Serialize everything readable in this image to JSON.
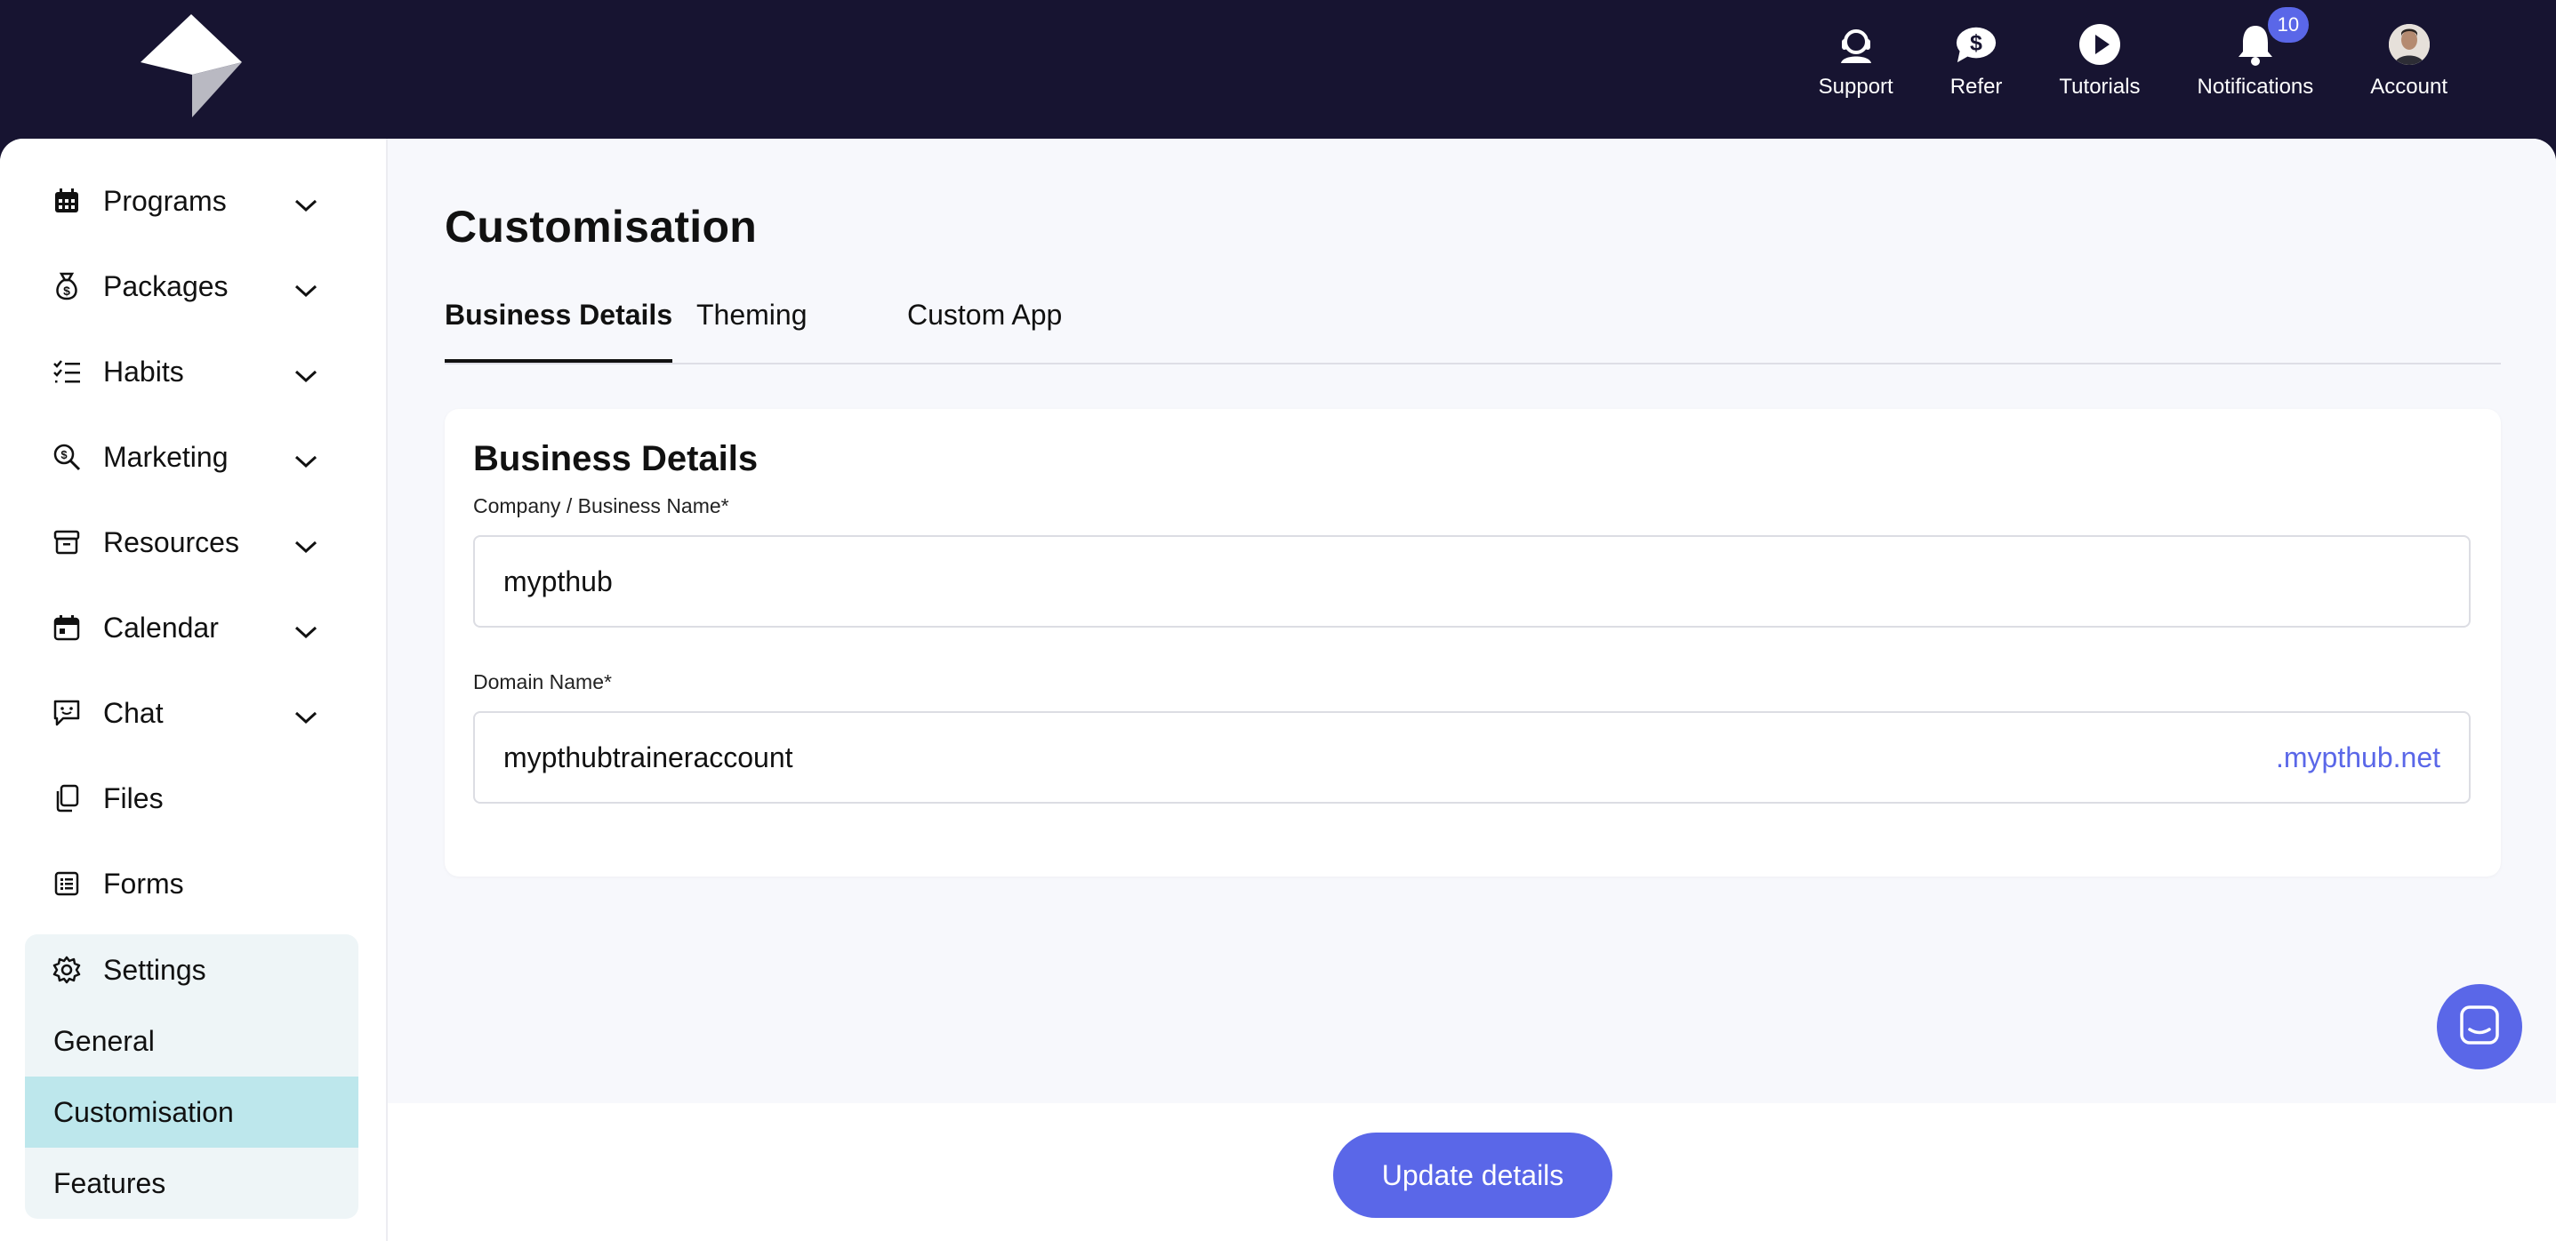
{
  "header": {
    "logo_icon": "brand-logo-icon",
    "items": [
      {
        "label": "Support",
        "icon": "headset-icon"
      },
      {
        "label": "Refer",
        "icon": "dollar-chat-icon"
      },
      {
        "label": "Tutorials",
        "icon": "play-icon"
      },
      {
        "label": "Notifications",
        "icon": "bell-icon",
        "badge": "10"
      },
      {
        "label": "Account",
        "icon": "avatar"
      }
    ]
  },
  "sidebar": {
    "items": [
      {
        "label": "Programs",
        "icon": "calendar-grid-icon",
        "expandable": true
      },
      {
        "label": "Packages",
        "icon": "money-bag-icon",
        "expandable": true
      },
      {
        "label": "Habits",
        "icon": "checklist-icon",
        "expandable": true
      },
      {
        "label": "Marketing",
        "icon": "search-dollar-icon",
        "expandable": true
      },
      {
        "label": "Resources",
        "icon": "archive-icon",
        "expandable": true
      },
      {
        "label": "Calendar",
        "icon": "calendar-icon",
        "expandable": true
      },
      {
        "label": "Chat",
        "icon": "chat-icon",
        "expandable": true
      },
      {
        "label": "Files",
        "icon": "files-icon",
        "expandable": false
      },
      {
        "label": "Forms",
        "icon": "form-icon",
        "expandable": false
      }
    ],
    "settings": {
      "label": "Settings",
      "icon": "gear-icon",
      "children": [
        "General",
        "Customisation",
        "Features"
      ],
      "active_child": "Customisation"
    }
  },
  "main": {
    "title": "Customisation",
    "tabs": [
      "Business Details",
      "Theming",
      "Custom App"
    ],
    "active_tab": "Business Details",
    "card": {
      "title": "Business Details",
      "fields": [
        {
          "label": "Company / Business Name*",
          "value": "mypthub"
        },
        {
          "label": "Domain Name*",
          "value": "mypthubtraineraccount",
          "suffix": ".mypthub.net"
        }
      ]
    }
  },
  "footer": {
    "update_label": "Update details"
  },
  "colors": {
    "topbar": "#171431",
    "accent": "#5a67e8",
    "active_sub": "#bde7ec",
    "settings_bg": "#eef5f7"
  }
}
